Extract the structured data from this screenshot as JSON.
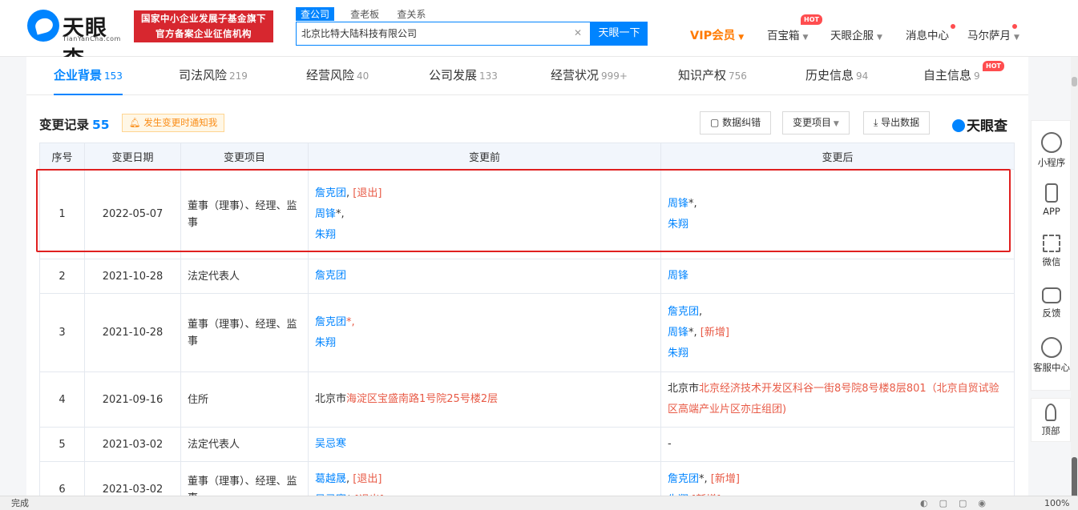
{
  "brand": {
    "logo_text": "天眼查",
    "logo_sub": "TianYanCha.com",
    "gov_line1": "国家中小企业发展子基金旗下",
    "gov_line2": "官方备案企业征信机构"
  },
  "search": {
    "tabs": [
      "查公司",
      "查老板",
      "查关系"
    ],
    "value": "北京比特大陆科技有限公司",
    "button": "天眼一下"
  },
  "topnav": {
    "vip": "VIP会员",
    "treasure": "百宝箱",
    "hot": "HOT",
    "enterprise": "天眼企服",
    "messages": "消息中心",
    "user": "马尔萨月"
  },
  "tabs": [
    {
      "label": "企业背景",
      "count": "153"
    },
    {
      "label": "司法风险",
      "count": "219"
    },
    {
      "label": "经营风险",
      "count": "40"
    },
    {
      "label": "公司发展",
      "count": "133"
    },
    {
      "label": "经营状况",
      "count": "999+"
    },
    {
      "label": "知识产权",
      "count": "756"
    },
    {
      "label": "历史信息",
      "count": "94"
    },
    {
      "label": "自主信息",
      "count": "9",
      "badge": "HOT"
    }
  ],
  "section": {
    "title": "变更记录",
    "count": "55",
    "notify": "发生变更时通知我",
    "btn_correct": "数据纠错",
    "btn_filter": "变更项目",
    "btn_export": "导出数据",
    "brand": "天眼查"
  },
  "table": {
    "headers": [
      "序号",
      "变更日期",
      "变更项目",
      "变更前",
      "变更后"
    ]
  },
  "floatbar": {
    "miniprogram": "小程序",
    "app": "APP",
    "wechat": "微信",
    "feedback": "反馈",
    "service": "客服中心",
    "top": "顶部"
  },
  "status": {
    "text": "完成",
    "zoom": "100%"
  },
  "colors": {
    "accent": "#0084ff",
    "red": "#e85a46",
    "vip": "#ff7a00",
    "highlight": "#e02020"
  }
}
